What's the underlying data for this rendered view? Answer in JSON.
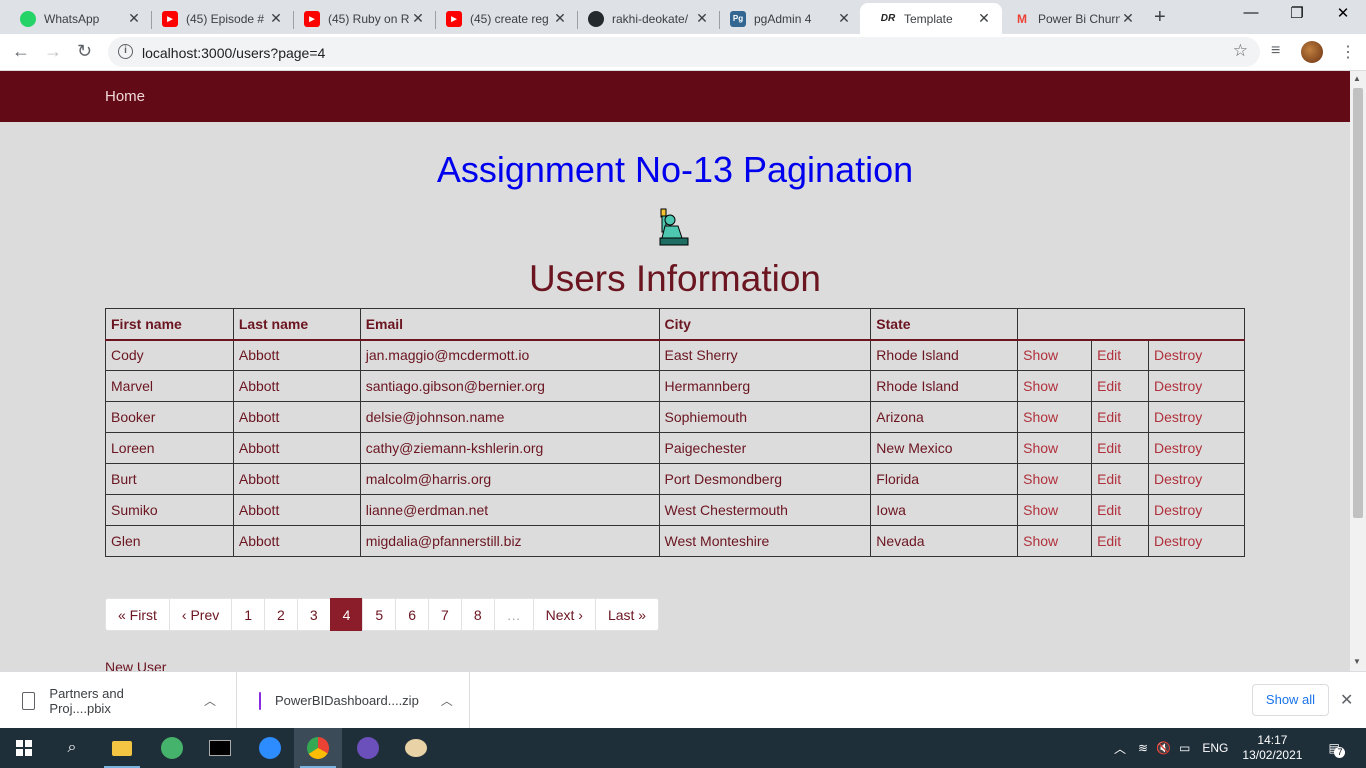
{
  "browser": {
    "tabs": [
      {
        "title": "WhatsApp",
        "color": "#25d366",
        "glyph": "●"
      },
      {
        "title": "(45) Episode #",
        "color": "#ff0000",
        "glyph": "▶"
      },
      {
        "title": "(45) Ruby on R",
        "color": "#ff0000",
        "glyph": "▶"
      },
      {
        "title": "(45) create reg",
        "color": "#ff0000",
        "glyph": "▶"
      },
      {
        "title": "rakhi-deokate/",
        "color": "#24292e",
        "glyph": "●"
      },
      {
        "title": "pgAdmin 4",
        "color": "#336791",
        "glyph": "Pg"
      },
      {
        "title": "Template",
        "color": "#222222",
        "glyph": "DR"
      },
      {
        "title": "Power Bi Churn",
        "color": "#ea4335",
        "glyph": "M"
      }
    ],
    "url": "localhost:3000/users?page=4"
  },
  "page": {
    "nav_home": "Home",
    "title": "Assignment No-13 Pagination",
    "heading": "Users Information",
    "new_user": "New User"
  },
  "table": {
    "headers": [
      "First name",
      "Last name",
      "Email",
      "City",
      "State"
    ],
    "action_labels": {
      "show": "Show",
      "edit": "Edit",
      "destroy": "Destroy"
    },
    "rows": [
      {
        "first": "Cody",
        "last": "Abbott",
        "email": "jan.maggio@mcdermott.io",
        "city": "East Sherry",
        "state": "Rhode Island"
      },
      {
        "first": "Marvel",
        "last": "Abbott",
        "email": "santiago.gibson@bernier.org",
        "city": "Hermannberg",
        "state": "Rhode Island"
      },
      {
        "first": "Booker",
        "last": "Abbott",
        "email": "delsie@johnson.name",
        "city": "Sophiemouth",
        "state": "Arizona"
      },
      {
        "first": "Loreen",
        "last": "Abbott",
        "email": "cathy@ziemann-kshlerin.org",
        "city": "Paigechester",
        "state": "New Mexico"
      },
      {
        "first": "Burt",
        "last": "Abbott",
        "email": "malcolm@harris.org",
        "city": "Port Desmondberg",
        "state": "Florida"
      },
      {
        "first": "Sumiko",
        "last": "Abbott",
        "email": "lianne@erdman.net",
        "city": "West Chestermouth",
        "state": "Iowa"
      },
      {
        "first": "Glen",
        "last": "Abbott",
        "email": "migdalia@pfannerstill.biz",
        "city": "West Monteshire",
        "state": "Nevada"
      }
    ]
  },
  "pagination": {
    "first": "« First",
    "prev": "‹ Prev",
    "pages": [
      "1",
      "2",
      "3",
      "4",
      "5",
      "6",
      "7",
      "8"
    ],
    "current": "4",
    "gap": "…",
    "next": "Next ›",
    "last": "Last »"
  },
  "downloads": {
    "items": [
      {
        "name": "Partners and Proj....pbix"
      },
      {
        "name": "PowerBIDashboard....zip"
      }
    ],
    "show_all": "Show all"
  },
  "taskbar": {
    "lang": "ENG",
    "time": "14:17",
    "date": "13/02/2021",
    "notifications": "7"
  },
  "colors": {
    "navbar": "#620a15",
    "title_blue": "#0000ee",
    "maroon_text": "#6b1520",
    "active_page": "#8b1d2a"
  }
}
